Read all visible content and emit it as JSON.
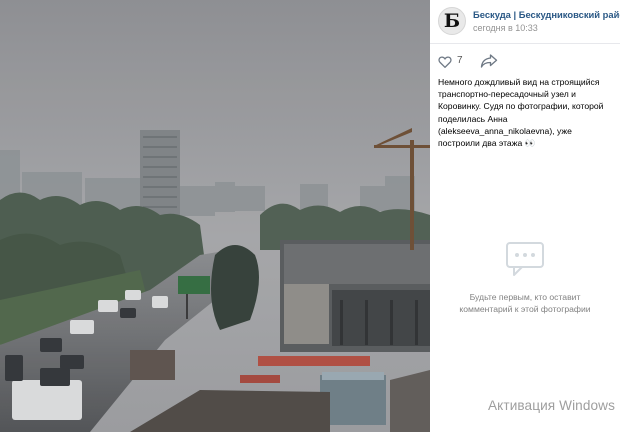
{
  "post": {
    "group_name": "Бескуда | Бескудниковский район",
    "time": "сегодня в 10:33",
    "avatar_letter": "Б",
    "like_count": "7",
    "text": "Немного дождливый вид на строящийся транспортно-пересадочный узел и Коровинку. Судя по фотографии, которой поделилась Анна (alekseeva_anna_nikolaevna), уже построили два этажа 👀"
  },
  "comments": {
    "empty_text": "Будьте первым, кто оставит комментарий к этой фотографии"
  },
  "watermark": {
    "text": "Активация Windows"
  },
  "icons": {
    "like": "heart-icon",
    "share": "share-arrow-icon",
    "comments": "comment-bubble-icon"
  },
  "colors": {
    "link": "#2a5885",
    "muted": "#828282"
  }
}
